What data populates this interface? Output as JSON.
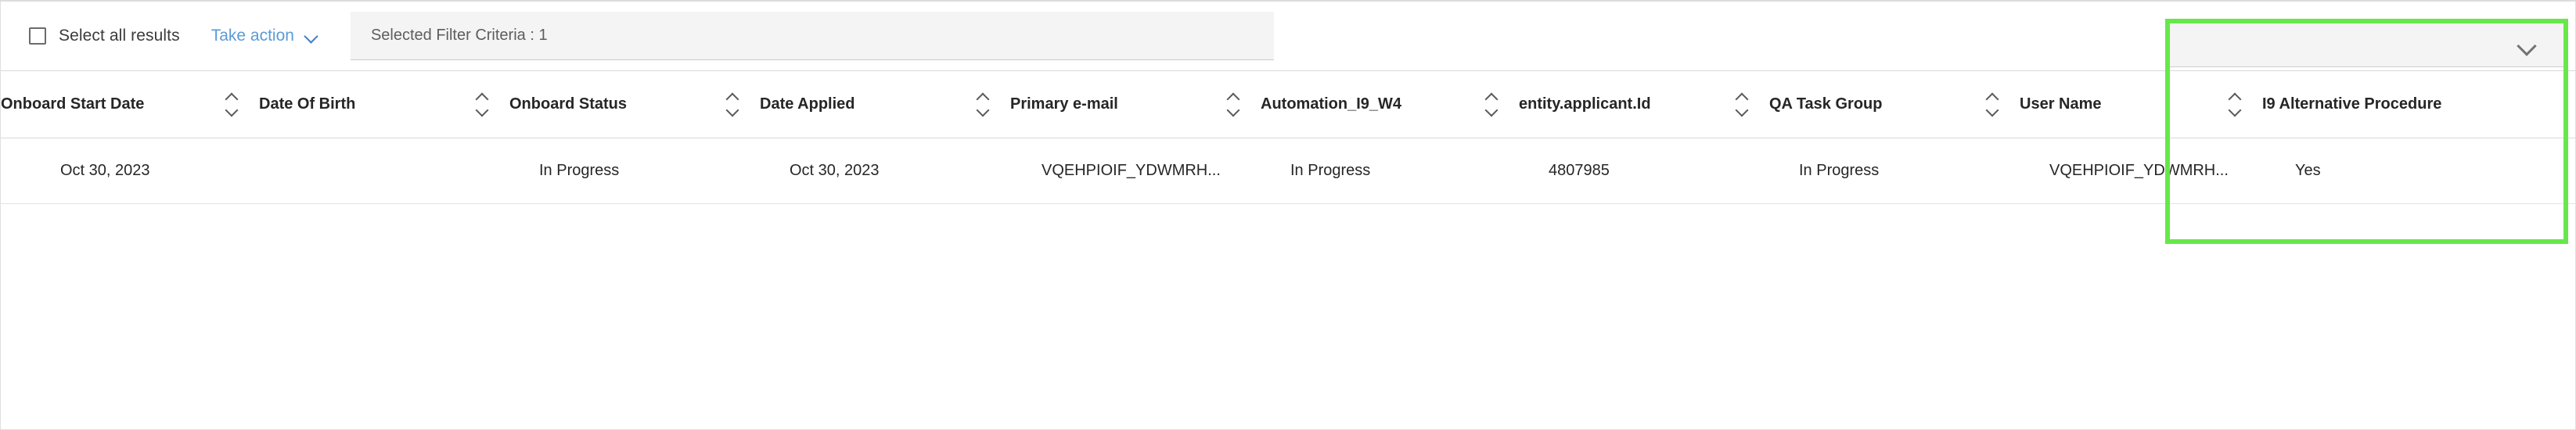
{
  "toolbar": {
    "select_all_label": "Select all results",
    "select_all_checked": false,
    "take_action_label": "Take action",
    "take_action_icon": "chevron-down-icon",
    "filter_criteria_label": "Selected Filter Criteria : 1",
    "collapse_icon": "chevron-down-icon"
  },
  "highlight": {
    "color": "#66e84a",
    "note": "green annotation rectangle around User Name / I9 Alternative Procedure columns"
  },
  "theme": {
    "link_color": "#3f7fc1",
    "text_color": "#262626",
    "muted_text_color": "#5d5d5d",
    "chip_background": "#f4f4f4",
    "border_color": "#d8d8d8",
    "highlight_green": "#66e84a"
  },
  "table": {
    "columns": [
      {
        "label": "Onboard Start Date",
        "sortable": true,
        "sort_icon": "sort-arrows-icon"
      },
      {
        "label": "Date Of Birth",
        "sortable": true,
        "sort_icon": "sort-arrows-icon"
      },
      {
        "label": "Onboard Status",
        "sortable": true,
        "sort_icon": "sort-arrows-icon"
      },
      {
        "label": "Date Applied",
        "sortable": true,
        "sort_icon": "sort-arrows-icon"
      },
      {
        "label": "Primary e-mail",
        "sortable": true,
        "sort_icon": "sort-arrows-icon"
      },
      {
        "label": "Automation_I9_W4",
        "sortable": true,
        "sort_icon": "sort-arrows-icon"
      },
      {
        "label": "entity.applicant.Id",
        "sortable": true,
        "sort_icon": "sort-arrows-icon"
      },
      {
        "label": "QA Task Group",
        "sortable": true,
        "sort_icon": "sort-arrows-icon"
      },
      {
        "label": "User Name",
        "sortable": true,
        "sort_icon": "sort-arrows-icon"
      },
      {
        "label": "I9 Alternative Procedure",
        "sortable": false,
        "sort_icon": ""
      }
    ],
    "rows": [
      {
        "onboard_start_date": "Oct 30, 2023",
        "date_of_birth": "",
        "onboard_status": "In Progress",
        "date_applied": "Oct 30, 2023",
        "primary_email": "VQEHPIOIF_YDWMRH...",
        "automation_i9_w4": "In Progress",
        "entity_applicant_id": "4807985",
        "qa_task_group": "In Progress",
        "user_name": "VQEHPIOIF_YDWMRH...",
        "i9_alternative_procedure": "Yes"
      }
    ],
    "link_cells": [
      "primary_email",
      "automation_i9_w4",
      "qa_task_group"
    ]
  }
}
